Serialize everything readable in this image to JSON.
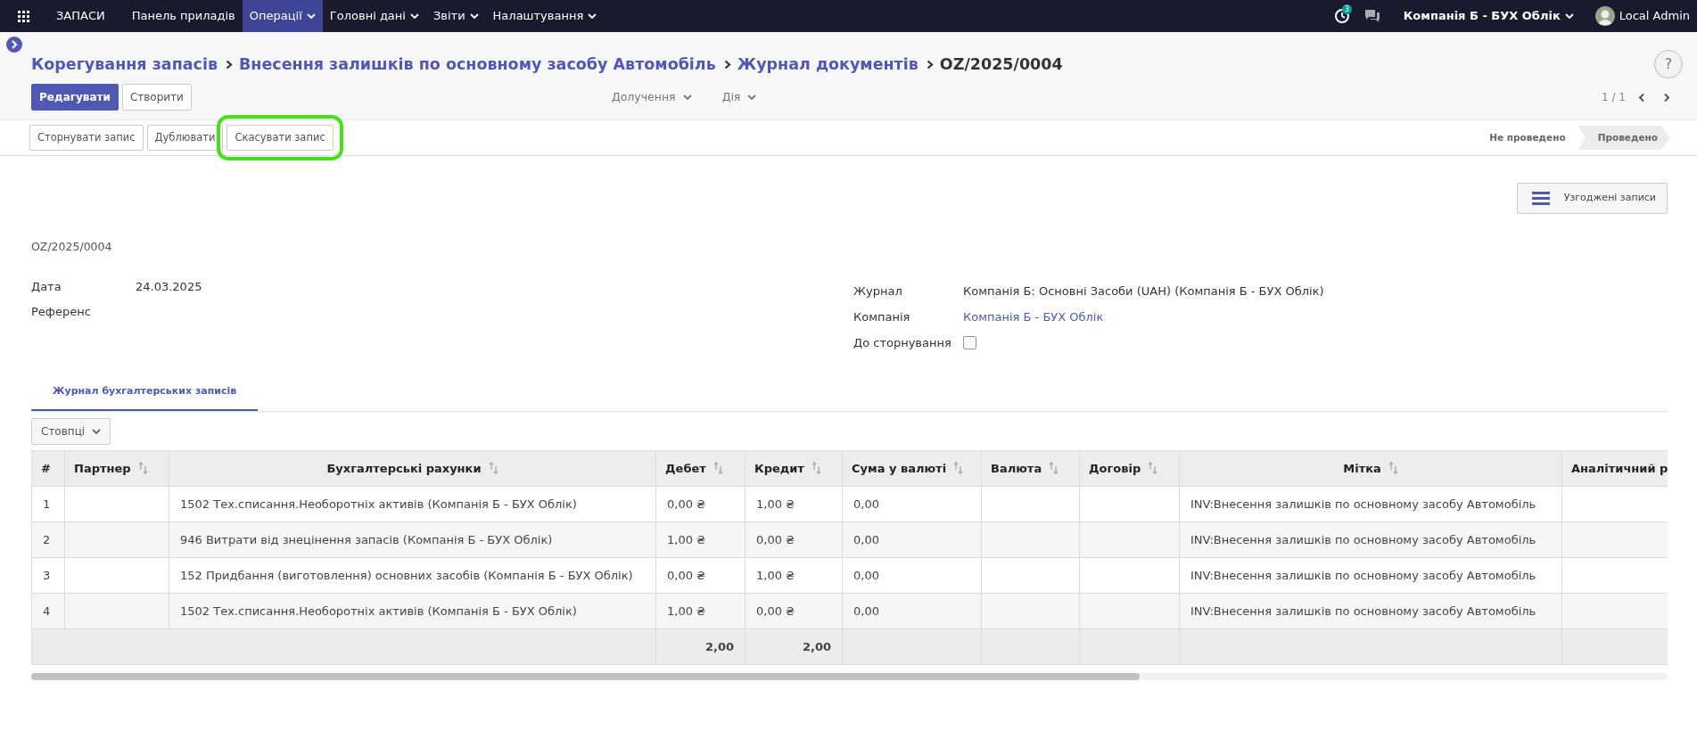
{
  "navbar": {
    "app_name": "ЗАПАСИ",
    "menu": [
      {
        "label": "Панель приладів",
        "dropdown": false,
        "selected": false
      },
      {
        "label": "Операції",
        "dropdown": true,
        "selected": true
      },
      {
        "label": "Головні дані",
        "dropdown": true,
        "selected": false
      },
      {
        "label": "Звіти",
        "dropdown": true,
        "selected": false
      },
      {
        "label": "Налаштування",
        "dropdown": true,
        "selected": false
      }
    ],
    "activity_count": "3",
    "company": "Компанія Б - БУХ Облік",
    "user": "Local Admin"
  },
  "breadcrumb": [
    {
      "label": "Корегування запасів",
      "link": true
    },
    {
      "label": "Внесення залишків по основному засобу Автомобіль",
      "link": true
    },
    {
      "label": "Журнал документів",
      "link": true
    },
    {
      "label": "OZ/2025/0004",
      "link": false
    }
  ],
  "help": "?",
  "buttons": [
    {
      "label": "Редагувати",
      "primary": true
    },
    {
      "label": "Створити",
      "primary": false
    }
  ],
  "dropdowns": [
    "Долучення",
    "Дія"
  ],
  "pager": "1 / 1",
  "header_buttons": [
    {
      "label": "Сторнувати запис",
      "highlighted": false
    },
    {
      "label": "Дублювати",
      "highlighted": false
    },
    {
      "label": "Скасувати запис",
      "highlighted": true
    }
  ],
  "statusbar": [
    {
      "label": "Не проведено",
      "selected": false
    },
    {
      "label": "Проведено",
      "selected": true
    }
  ],
  "smart_button": "Узгоджені записи",
  "record_name": "OZ/2025/0004",
  "fields_left": [
    {
      "label": "Дата",
      "value": "24.03.2025"
    },
    {
      "label": "Референс"
    }
  ],
  "fields_right": [
    {
      "label": "Журнал",
      "kind": "text",
      "value": "Компанія Б: Основні Засоби (UAH) (Компанія Б - БУХ Облік)"
    },
    {
      "label": "Компанія",
      "kind": "link",
      "value": "Компанія Б - БУХ Облік"
    },
    {
      "label": "До сторнування",
      "kind": "checkbox",
      "checked": false
    }
  ],
  "tabs": [
    {
      "label": "Журнал бухгалтерських записів",
      "selected": true
    }
  ],
  "columns_button": "Стовпці",
  "table": {
    "columns": [
      {
        "label": "#",
        "sortable": false
      },
      {
        "label": "Партнер",
        "sortable": true
      },
      {
        "label": "Бухгалтерські рахунки",
        "sortable": true
      },
      {
        "label": "Дебет",
        "sortable": true
      },
      {
        "label": "Кредит",
        "sortable": true
      },
      {
        "label": "Сума у валюті",
        "sortable": true
      },
      {
        "label": "Валюта",
        "sortable": true
      },
      {
        "label": "Договір",
        "sortable": true
      },
      {
        "label": "Мітка",
        "sortable": true
      },
      {
        "label": "Аналітичний р"
      }
    ],
    "rows": [
      {
        "number": "1",
        "account": "1502 Тех.списання.Необоротніх активів (Компанія Б - БУХ Облік)",
        "debit": "0,00 ₴",
        "credit": "1,00 ₴",
        "amount_currency": "0,00",
        "label": "INV:Внесення залишків по основному засобу Автомобіль"
      },
      {
        "number": "2",
        "account": "946 Витрати від знецінення запасів (Компанія Б - БУХ Облік)",
        "debit": "1,00 ₴",
        "credit": "0,00 ₴",
        "amount_currency": "0,00",
        "label": "INV:Внесення залишків по основному засобу Автомобіль"
      },
      {
        "number": "3",
        "account": "152 Придбання (виготовлення) основних засобів (Компанія Б - БУХ Облік)",
        "debit": "0,00 ₴",
        "credit": "1,00 ₴",
        "amount_currency": "0,00",
        "label": "INV:Внесення залишків по основному засобу Автомобіль"
      },
      {
        "number": "4",
        "account": "1502 Тех.списання.Необоротніх активів (Компанія Б - БУХ Облік)",
        "debit": "1,00 ₴",
        "credit": "0,00 ₴",
        "amount_currency": "0,00",
        "label": "INV:Внесення залишків по основному засобу Автомобіль"
      }
    ],
    "totals": {
      "debit": "2,00",
      "credit": "2,00"
    }
  }
}
